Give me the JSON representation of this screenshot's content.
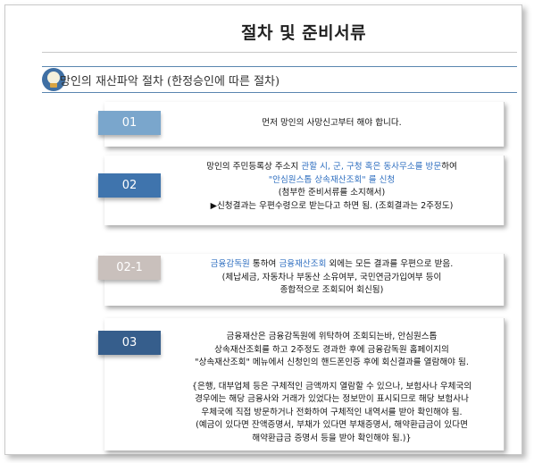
{
  "page_title": "절차 및 준비서류",
  "subtitle": "망인의 재산파악 절차 (한정승인에 따른 절차)",
  "icon": "lightbulb-icon",
  "colors": {
    "step01": "#7aa6cc",
    "step02": "#3f74ad",
    "step02_1": "#c9c0bc",
    "step03": "#365e8c",
    "highlight": "#2f6fc0"
  },
  "steps": [
    {
      "badge": "01",
      "lines": [
        "먼저 망인의 사망신고부터 해야 합니다."
      ]
    },
    {
      "badge": "02",
      "line1_a": "망인의 주민등록상 주소지 ",
      "line1_b": "관할 시, 군, 구청 혹은 동사무소를 방문",
      "line1_c": "하여",
      "line2": "\"안심원스톱 상속재산조회\" 를 신청",
      "line3": "(첨부한 준비서류를 소지해서)",
      "line4": "▶신청결과는 우편수령으로 받는다고 하면 됨. (조회결과는 2주정도)"
    },
    {
      "badge": "02-1",
      "line1_a": "금융감독원",
      "line1_b": " 통하여 ",
      "line1_c": "금융재산조회",
      "line1_d": " 외에는 모든 결과를 우편으로 받음.",
      "line2": "(체납세금, 자동차나 부동산 소유여부, 국민연금가입여부 등이",
      "line3": "종합적으로 조회되어 회신됨)"
    },
    {
      "badge": "03",
      "lines": [
        "금융재산은 금융감독원에 위탁하여 조회되는바, 안심원스톱",
        "상속재산조회를 하고 2주정도 경과한 후에 금융감독원 홈페이지의",
        "\"상속재산조회\" 메뉴에서 신청인의 핸드폰인증 후에 회신결과를 열람해야 됨.",
        "{은행, 대부업체 등은 구체적인 금액까지 열람할 수 있으나, 보험사나 우체국의",
        "경우에는 해당 금융사와 거래가 있었다는 정보만이 표시되므로 해당 보험사나",
        "우체국에 직접 방문하거나 전화하여 구체적인 내역서를 받아 확인해야 됨.",
        "(예금이 있다면 잔액증명서, 부채가 있다면 부채증명서, 해약환급금이 있다면",
        "해약환급금 증명서 등을 받아 확인해야 됨.)}"
      ]
    }
  ]
}
